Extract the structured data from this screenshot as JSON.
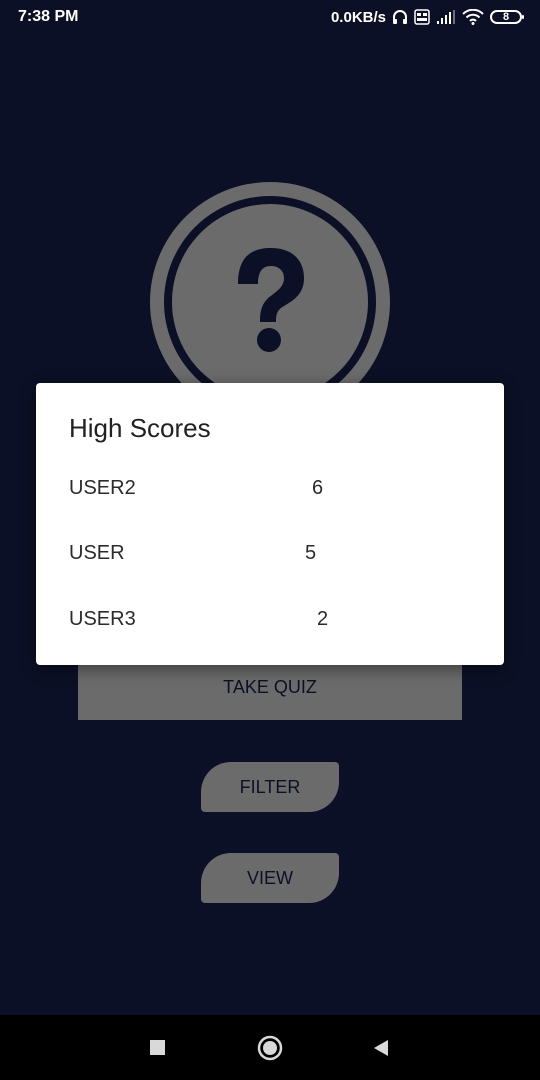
{
  "status_bar": {
    "time": "7:38 PM",
    "network_speed": "0.0KB/s",
    "battery_level": "8",
    "icons": [
      "headphones-icon",
      "volte-icon",
      "signal-icon",
      "wifi-icon",
      "battery-icon"
    ]
  },
  "app": {
    "logo_icon": "question-mark-circle-icon",
    "take_quiz_label": "TAKE QUIZ",
    "filter_label": "FILTER",
    "view_label": "VIEW"
  },
  "dialog": {
    "title": "High Scores",
    "scores": [
      {
        "user": "USER2",
        "score": "6"
      },
      {
        "user": "USER",
        "score": "5"
      },
      {
        "user": "USER3",
        "score": "2"
      }
    ]
  },
  "nav_bar": {
    "icons": [
      "recent-apps-icon",
      "home-icon",
      "back-icon"
    ]
  },
  "colors": {
    "background": "#0b1026",
    "dimmed_control": "#6b6b6b",
    "dialog": "#ffffff"
  }
}
